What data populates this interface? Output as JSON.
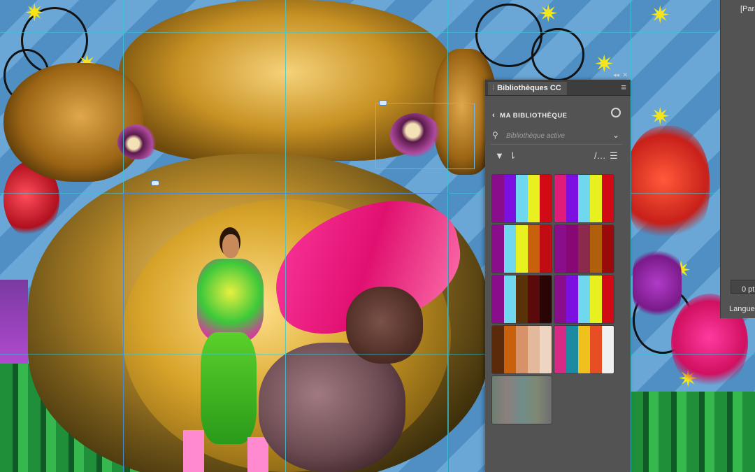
{
  "panel": {
    "title": "Bibliothèques CC",
    "collapse_label": "◂◂",
    "close_label": "✕",
    "menu_label": "≡",
    "back_label": "MA BIBLIOTHÈQUE",
    "search_placeholder": "Bibliothèque active",
    "themes": [
      {
        "colors": [
          "#8a0d8c",
          "#7c10e0",
          "#6fd8ef",
          "#e8f020",
          "#d20a15"
        ]
      },
      {
        "colors": [
          "#e01b7a",
          "#7c10e0",
          "#6fd8ef",
          "#e8f020",
          "#d20a15"
        ]
      },
      {
        "colors": [
          "#8a0d8c",
          "#6fd8ef",
          "#e8f020",
          "#c8600c",
          "#c20c14"
        ]
      },
      {
        "colors": [
          "#8a0d8c",
          "#870874",
          "#8b2a4c",
          "#b0600a",
          "#9b0a0a"
        ]
      },
      {
        "colors": [
          "#8a0d8c",
          "#6fd8ef",
          "#5a320a",
          "#5a0a0a",
          "#2a0505"
        ]
      },
      {
        "colors": [
          "#8a0d8c",
          "#7c10e0",
          "#6fd8ef",
          "#e8f020",
          "#d20a15"
        ]
      },
      {
        "colors": [
          "#5a2a0a",
          "#c8600c",
          "#d8926a",
          "#e4b89a",
          "#eed4c2"
        ]
      },
      {
        "colors": [
          "#d62a86",
          "#1c8aa0",
          "#f0c01c",
          "#e84e23",
          "#f0f0f0"
        ]
      },
      {
        "colors": [
          "#6c7f73",
          "#8c7f7c",
          "#6f8d8a",
          "#7f8873",
          "#6e6e6e"
        ]
      }
    ]
  },
  "icons": {
    "filter": "filter-icon",
    "sort": "sort-icon",
    "user": "user-add-icon",
    "search": "search-icon",
    "list_view": "list-view-icon",
    "pen": "pen-icon"
  },
  "dock": {
    "paragraph_label": "[Para",
    "stroke_value": "0 pt",
    "language_label": "Langue :"
  },
  "colors": {
    "panel_bg": "#535353",
    "titlebar_bg": "#3d3d3d",
    "guide": "#39c7d9"
  }
}
